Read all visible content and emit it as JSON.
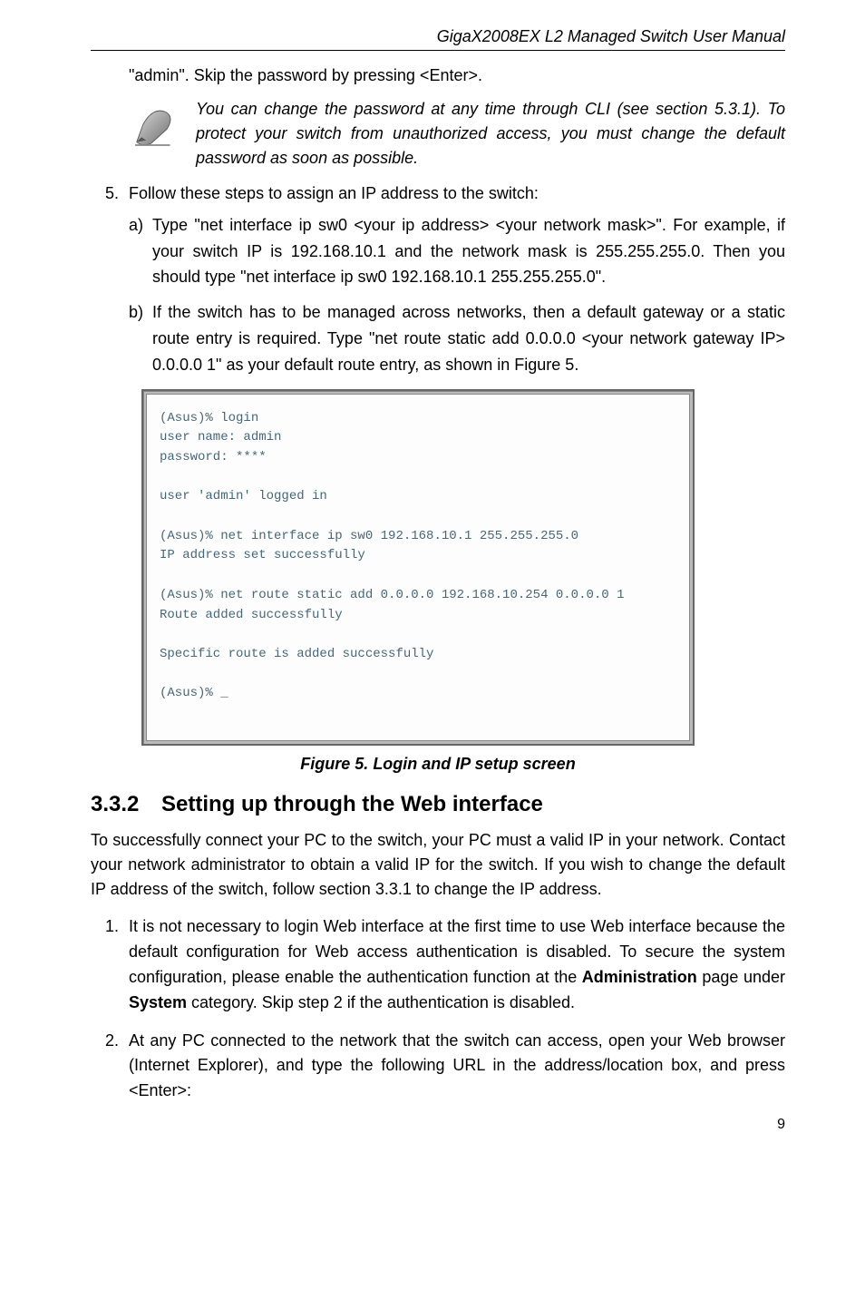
{
  "header": {
    "running_title": "GigaX2008EX L2 Managed Switch User Manual"
  },
  "intro": {
    "admin_line": "\"admin\". Skip the password by pressing <Enter>.",
    "note_text": "You can change the password at any time through CLI (see section 5.3.1). To protect your switch from unauthorized access, you must change the default password as soon as possible."
  },
  "step5": {
    "lead": "Follow these steps to assign an IP address to the switch:",
    "a": "Type \"net interface ip sw0 <your ip address> <your network mask>\". For example, if your switch IP is 192.168.10.1 and the network mask is 255.255.255.0. Then you should type \"net interface ip sw0 192.168.10.1 255.255.255.0\".",
    "b": "If the switch has to be managed across networks, then a default gateway or a static route entry is required. Type \"net route static add 0.0.0.0 <your network gateway IP> 0.0.0.0 1\" as your default route entry, as shown in Figure 5."
  },
  "terminal": {
    "content": "(Asus)% login\nuser name: admin\npassword: ****\n\nuser 'admin' logged in\n\n(Asus)% net interface ip sw0 192.168.10.1 255.255.255.0\nIP address set successfully\n\n(Asus)% net route static add 0.0.0.0 192.168.10.254 0.0.0.0 1\nRoute added successfully\n\nSpecific route is added successfully\n\n(Asus)% _"
  },
  "figure": {
    "caption": "Figure 5. Login and IP setup screen"
  },
  "section": {
    "number": "3.3.2",
    "title": "Setting up through the Web interface",
    "intro": "To successfully connect your PC to the switch, your PC must a valid IP in your network. Contact your network administrator to obtain a valid IP for the switch. If you wish to change the default IP address of the switch, follow section 3.3.1 to change the IP address."
  },
  "web_steps": {
    "s1_pre": "It is not necessary to login Web interface at the first time to use Web interface because the default configuration for Web access authentication is disabled. To secure the system configuration, please enable the authentication function at the ",
    "s1_admin": "Administration",
    "s1_mid": " page under ",
    "s1_system": "System",
    "s1_post": " category. Skip step 2 if the authentication is disabled.",
    "s2": "At any PC connected to the network that the switch can access, open your Web browser (Internet Explorer), and type the following URL in the address/location box, and press <Enter>:"
  },
  "footer": {
    "page_number": "9"
  }
}
